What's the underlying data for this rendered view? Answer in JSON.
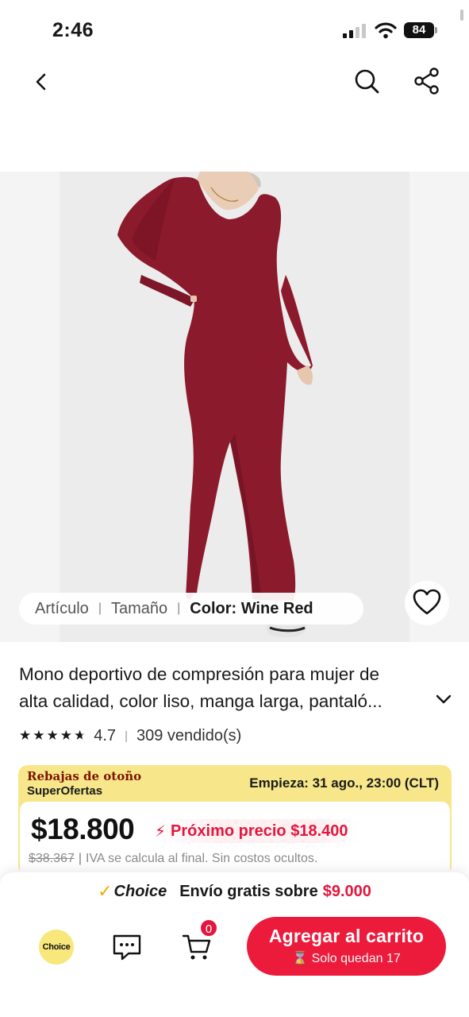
{
  "status_bar": {
    "time": "2:46",
    "battery": "84"
  },
  "nav": {
    "back": "back-icon",
    "search": "search-icon",
    "share": "share-icon"
  },
  "product": {
    "variants": {
      "item": "Artículo",
      "size": "Tamaño",
      "color": "Color: Wine Red"
    },
    "title_line1": "Mono deportivo de compresión para mujer de",
    "title_line2": "alta calidad, color liso, manga larga, pantaló...",
    "rating": "4.7",
    "sold": "309 vendido(s)",
    "stars": 4.7
  },
  "promo": {
    "event": "Rebajas de otoño",
    "program": "SuperOfertas",
    "start": "Empieza: 31 ago., 23:00 (CLT)",
    "price": "$18.800",
    "next_price": "Próximo precio $18.400",
    "old_price": "$38.367",
    "tax_note": "IVA se calcula al final. Sin costos ocultos."
  },
  "shipping": {
    "check": "✓",
    "choice": "Choice",
    "text": "Envío gratis sobre",
    "amount": "$9.000"
  },
  "actions": {
    "choice_badge": "Choice",
    "cart_count": "0",
    "add_to_cart": "Agregar al carrito",
    "stock": "⌛ Solo quedan 17"
  },
  "colors": {
    "accent": "#ec1b3b",
    "promo_yellow": "#f7e78a",
    "product": "#8b1a2c"
  }
}
